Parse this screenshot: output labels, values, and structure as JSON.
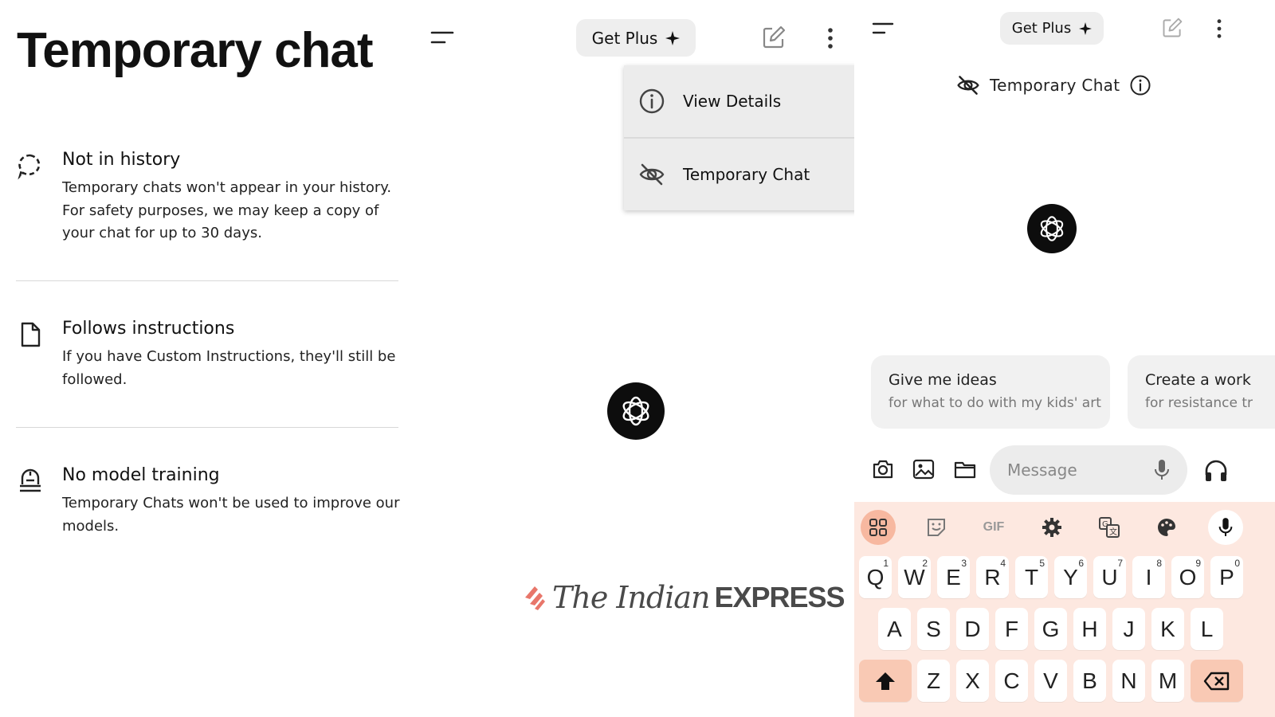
{
  "panel1": {
    "title": "Temporary chat",
    "features": [
      {
        "icon": "dashed-chat-bubble-icon",
        "title": "Not in history",
        "desc": "Temporary chats won't appear in your history. For safety purposes, we may keep a copy of your chat for up to 30 days."
      },
      {
        "icon": "document-icon",
        "title": "Follows instructions",
        "desc": "If you have Custom Instructions, they'll still be followed."
      },
      {
        "icon": "no-training-icon",
        "title": "No model training",
        "desc": "Temporary Chats won't be used to improve our models."
      }
    ]
  },
  "panel2": {
    "get_plus_label": "Get Plus",
    "menu": [
      {
        "icon": "info-icon",
        "label": "View Details"
      },
      {
        "icon": "eye-off-icon",
        "label": "Temporary Chat"
      }
    ],
    "watermark": {
      "serif": "The Indian",
      "bold": "EXPRESS"
    }
  },
  "panel3": {
    "get_plus_label": "Get Plus",
    "header_label": "Temporary Chat",
    "suggestions": [
      {
        "title": "Give me ideas",
        "subtitle": "for what to do with my kids' art"
      },
      {
        "title": "Create a work",
        "subtitle": "for resistance tr"
      }
    ],
    "message_placeholder": "Message",
    "keyboard": {
      "toolbar": [
        "apps-icon",
        "sticker-icon",
        "gif-icon",
        "settings-gear-icon",
        "translate-icon",
        "palette-icon",
        "keyboard-mic-icon"
      ],
      "gif_label": "GIF",
      "row1": [
        [
          "Q",
          "1"
        ],
        [
          "W",
          "2"
        ],
        [
          "E",
          "3"
        ],
        [
          "R",
          "4"
        ],
        [
          "T",
          "5"
        ],
        [
          "Y",
          "6"
        ],
        [
          "U",
          "7"
        ],
        [
          "I",
          "8"
        ],
        [
          "O",
          "9"
        ],
        [
          "P",
          "0"
        ]
      ],
      "row2": [
        "A",
        "S",
        "D",
        "F",
        "G",
        "H",
        "J",
        "K",
        "L"
      ],
      "row3": [
        "Z",
        "X",
        "C",
        "V",
        "B",
        "N",
        "M"
      ]
    }
  },
  "colors": {
    "keyboard_bg": "#fde8e0",
    "key_special": "#f9c9b4",
    "chip_bg": "#eeeeee",
    "logo_bg": "#0d0d0d"
  }
}
